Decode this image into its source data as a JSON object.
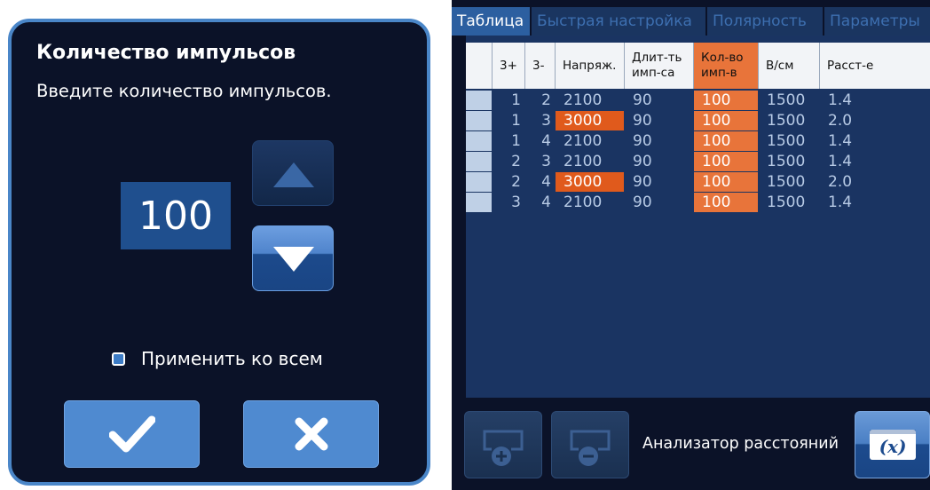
{
  "dialog": {
    "title": "Количество импульсов",
    "subtitle": "Введите количество импульсов.",
    "value": "100",
    "up_icon": "triangle-up-icon",
    "down_icon": "triangle-down-icon",
    "apply_all_label": "Применить ко всем",
    "apply_all_checked": true,
    "ok_icon": "checkmark-icon",
    "cancel_icon": "close-icon"
  },
  "tabs": [
    {
      "label": "Таблица",
      "active": true
    },
    {
      "label": "Быстрая настройка",
      "active": false
    },
    {
      "label": "Полярность",
      "active": false
    },
    {
      "label": "Параметры",
      "active": false
    }
  ],
  "table": {
    "headers": [
      "",
      "3+",
      "3-",
      "Напряж.",
      "Длит-ть имп-са",
      "Кол-во имп-в",
      "В/см",
      "Расст-е"
    ],
    "rows": [
      {
        "plus": "1",
        "minus": "2",
        "voltage": "2100",
        "duration": "90",
        "count": "100",
        "vcm": "1500",
        "distance": "1.4",
        "voltage_highlight": false
      },
      {
        "plus": "1",
        "minus": "3",
        "voltage": "3000",
        "duration": "90",
        "count": "100",
        "vcm": "1500",
        "distance": "2.0",
        "voltage_highlight": true
      },
      {
        "plus": "1",
        "minus": "4",
        "voltage": "2100",
        "duration": "90",
        "count": "100",
        "vcm": "1500",
        "distance": "1.4",
        "voltage_highlight": false
      },
      {
        "plus": "2",
        "minus": "3",
        "voltage": "2100",
        "duration": "90",
        "count": "100",
        "vcm": "1500",
        "distance": "1.4",
        "voltage_highlight": false
      },
      {
        "plus": "2",
        "minus": "4",
        "voltage": "3000",
        "duration": "90",
        "count": "100",
        "vcm": "1500",
        "distance": "2.0",
        "voltage_highlight": true
      },
      {
        "plus": "3",
        "minus": "4",
        "voltage": "2100",
        "duration": "90",
        "count": "100",
        "vcm": "1500",
        "distance": "1.4",
        "voltage_highlight": false
      }
    ]
  },
  "bottom_bar": {
    "add_icon": "add-row-icon",
    "remove_icon": "remove-row-icon",
    "analyzer_label": "Анализатор расстояний",
    "analyzer_icon": "formula-x-icon",
    "analyzer_icon_text": "(x)"
  },
  "colors": {
    "background": "#0b1228",
    "accent_blue": "#4f8ad0",
    "highlight_orange": "#e8743a",
    "table_bg": "#1a3462"
  }
}
